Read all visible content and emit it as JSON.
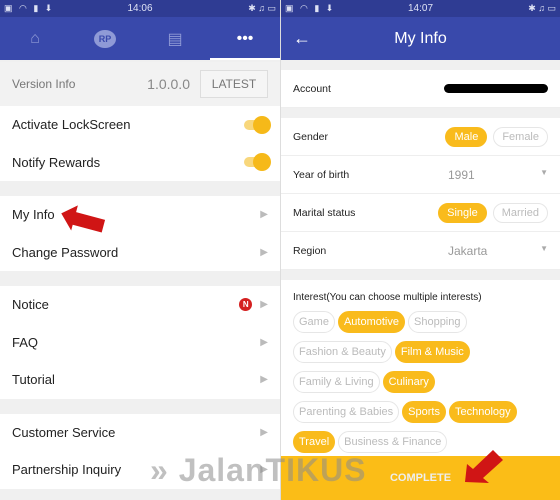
{
  "left": {
    "status": {
      "time": "14:06"
    },
    "tabs": [
      {
        "icon": "home-icon"
      },
      {
        "icon": "rp-icon",
        "label": "RP"
      },
      {
        "icon": "store-icon"
      },
      {
        "icon": "more-icon",
        "label": "•••",
        "active": true
      }
    ],
    "version": {
      "label": "Version Info",
      "value": "1.0.0.0",
      "button": "LATEST"
    },
    "toggles": [
      {
        "label": "Activate LockScreen",
        "on": true
      },
      {
        "label": "Notify Rewards",
        "on": true
      }
    ],
    "account": [
      {
        "label": "My Info"
      },
      {
        "label": "Change Password"
      }
    ],
    "help": [
      {
        "label": "Notice",
        "badge": "N"
      },
      {
        "label": "FAQ"
      },
      {
        "label": "Tutorial"
      }
    ],
    "contact": [
      {
        "label": "Customer Service"
      },
      {
        "label": "Partnership Inquiry"
      }
    ]
  },
  "right": {
    "status": {
      "time": "14:07"
    },
    "title": "My Info",
    "account_label": "Account",
    "gender": {
      "label": "Gender",
      "options": [
        "Male",
        "Female"
      ],
      "selected": "Male"
    },
    "year": {
      "label": "Year of birth",
      "value": "1991"
    },
    "marital": {
      "label": "Marital status",
      "options": [
        "Single",
        "Married"
      ],
      "selected": "Single"
    },
    "region": {
      "label": "Region",
      "value": "Jakarta"
    },
    "interest_title": "Interest(You can choose multiple interests)",
    "interests": [
      {
        "label": "Game",
        "on": false
      },
      {
        "label": "Automotive",
        "on": true
      },
      {
        "label": "Shopping",
        "on": false
      },
      {
        "label": "Fashion & Beauty",
        "on": false
      },
      {
        "label": "Film & Music",
        "on": true
      },
      {
        "label": "Family & Living",
        "on": false
      },
      {
        "label": "Culinary",
        "on": true
      },
      {
        "label": "Parenting & Babies",
        "on": false
      },
      {
        "label": "Sports",
        "on": true
      },
      {
        "label": "Technology",
        "on": true
      },
      {
        "label": "Travel",
        "on": true
      },
      {
        "label": "Business & Finance",
        "on": false
      }
    ],
    "complete": "COMPLETE"
  },
  "watermark": "JalanTIKUS",
  "colors": {
    "primary": "#3949ab",
    "accent": "#f9bb1c",
    "badge": "#d42020"
  }
}
